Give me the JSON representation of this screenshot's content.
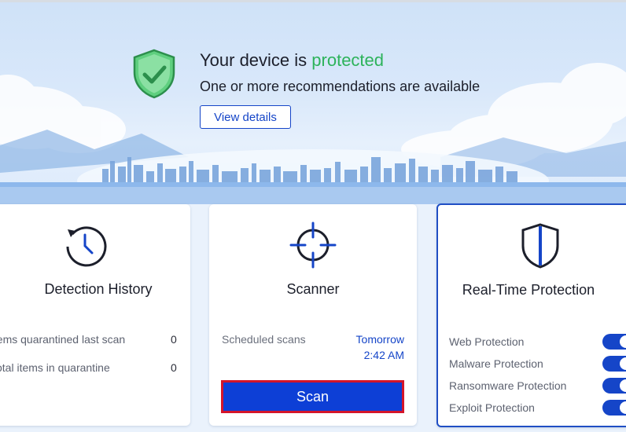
{
  "hero": {
    "title_prefix": "Your device is ",
    "title_status": "protected",
    "subtitle": "One or more recommendations are available",
    "view_details_label": "View details"
  },
  "cards": {
    "detection_history": {
      "title": "Detection History",
      "stats": [
        {
          "label": "Items quarantined last scan",
          "value": "0"
        },
        {
          "label": "Total items in quarantine",
          "value": "0"
        }
      ]
    },
    "scanner": {
      "title": "Scanner",
      "schedule_label": "Scheduled scans",
      "schedule_day": "Tomorrow",
      "schedule_time": "2:42 AM",
      "scan_label": "Scan"
    },
    "real_time_protection": {
      "title": "Real-Time Protection",
      "items": [
        {
          "label": "Web Protection",
          "enabled": true
        },
        {
          "label": "Malware Protection",
          "enabled": true
        },
        {
          "label": "Ransomware Protection",
          "enabled": true
        },
        {
          "label": "Exploit Protection",
          "enabled": true
        }
      ]
    }
  },
  "colors": {
    "accent": "#1545c8",
    "protected_green": "#2db35b",
    "scan_button": "#0d3fd6",
    "highlight_border": "#d4152a"
  },
  "icons": [
    "shield-check-icon",
    "history-clock-icon",
    "crosshair-icon",
    "shield-icon"
  ]
}
